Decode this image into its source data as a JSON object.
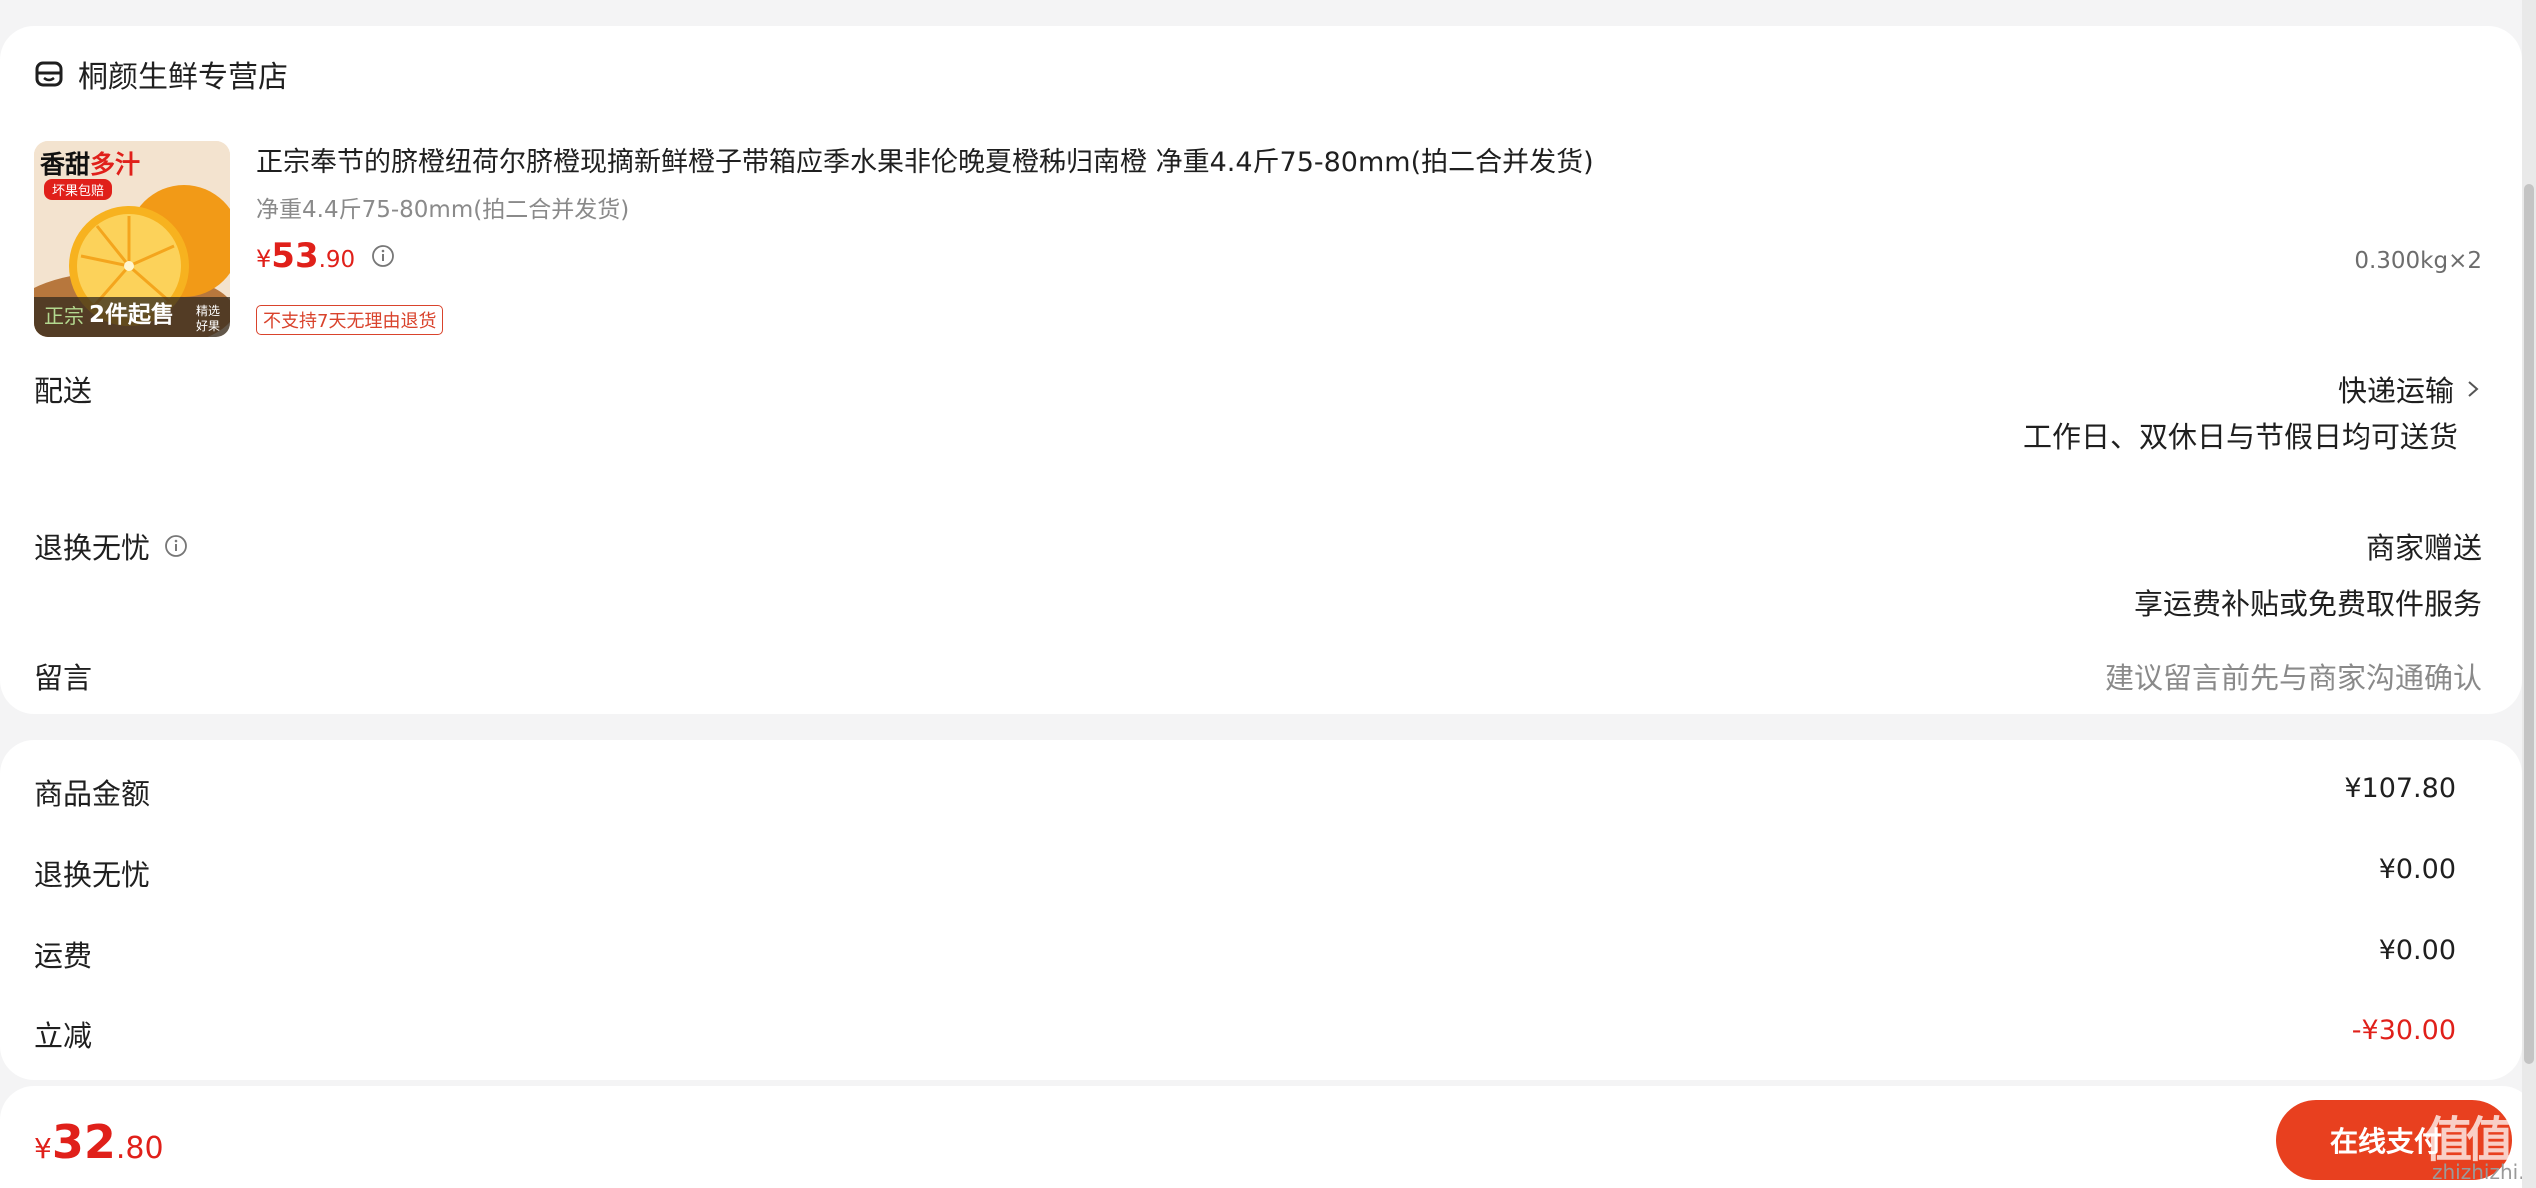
{
  "shop": {
    "icon": "shop-icon",
    "name": "桐颜生鲜专营店"
  },
  "product": {
    "thumb": {
      "title_black": "香甜",
      "title_red": "多汁",
      "badge": "坏果包赔",
      "bottom_left": "正宗",
      "bottom_main": "2件起售",
      "bottom_right_1": "精选",
      "bottom_right_2": "好果"
    },
    "title": "正宗奉节的脐橙纽荷尔脐橙现摘新鲜橙子带箱应季水果非伦晚夏橙秭归南橙 净重4.4斤75-80mm(拍二合并发货)",
    "spec": "净重4.4斤75-80mm(拍二合并发货)",
    "price": {
      "symbol": "¥",
      "integer": "53",
      "decimal": ".90"
    },
    "quantity": "0.300kg×2",
    "tag": "不支持7天无理由退货"
  },
  "delivery": {
    "label": "配送",
    "method": "快递运输",
    "note": "工作日、双休日与节假日均可送货"
  },
  "return_worry": {
    "label": "退换无忧",
    "value": "商家赠送",
    "note": "享运费补贴或免费取件服务"
  },
  "message": {
    "label": "留言",
    "placeholder": "建议留言前先与商家沟通确认"
  },
  "summary": [
    {
      "label": "商品金额",
      "value": "¥107.80",
      "red": false
    },
    {
      "label": "退换无忧",
      "value": "¥0.00",
      "red": false
    },
    {
      "label": "运费",
      "value": "¥0.00",
      "red": false
    },
    {
      "label": "立减",
      "value": "-¥30.00",
      "red": true
    }
  ],
  "footer": {
    "total": {
      "symbol": "¥",
      "integer": "32",
      "decimal": ".80"
    },
    "pay_button": "在线支付",
    "watermark": "值值值",
    "watermark_site": "zhizhizhi.com"
  },
  "colors": {
    "accent": "#e0201a",
    "button": "#e8401f",
    "muted": "#8a8a8a",
    "background": "#f4f4f5"
  }
}
